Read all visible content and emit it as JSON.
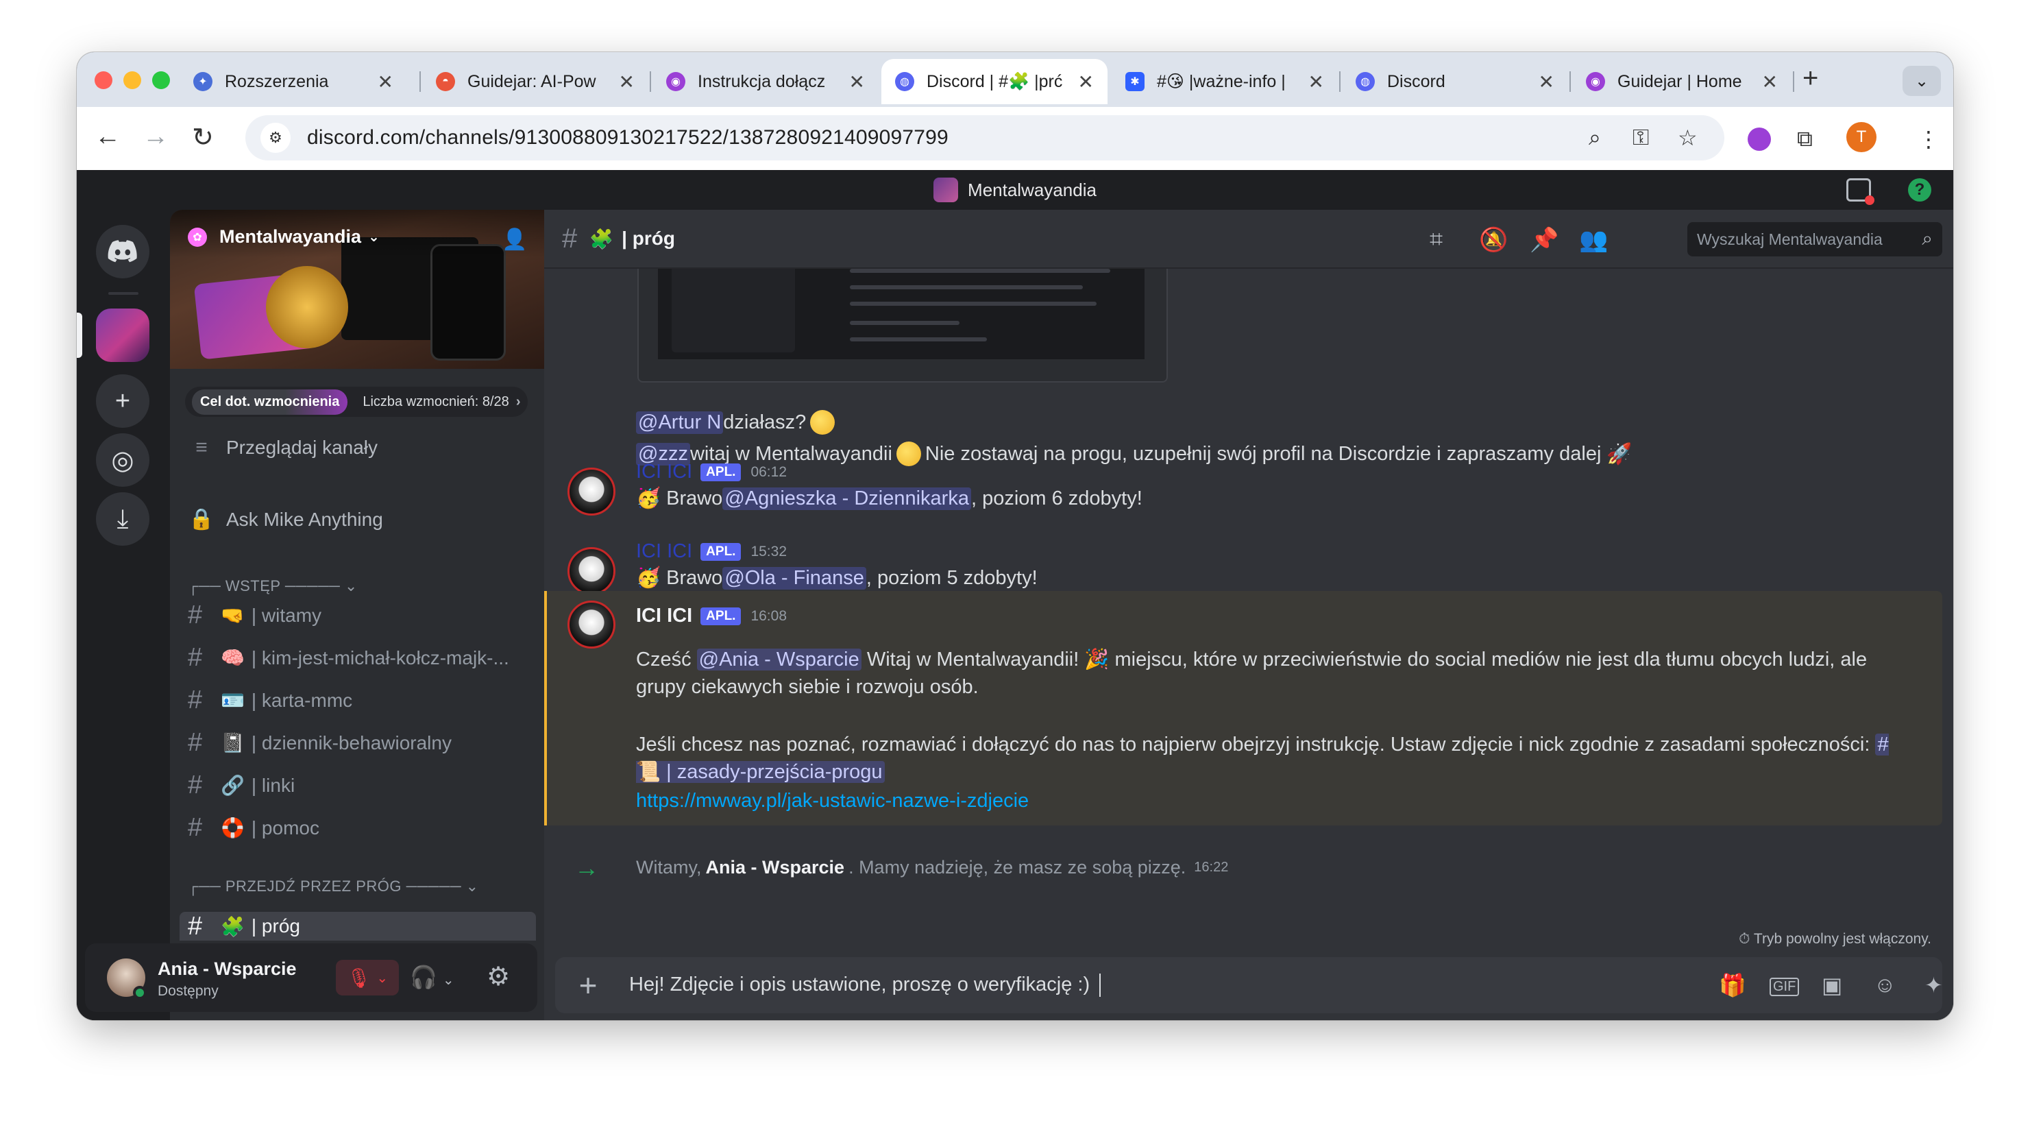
{
  "browser": {
    "tabs": [
      {
        "title": "Rozszerzenia",
        "active": false,
        "fav_color": "#4a6fd8",
        "fav_glyph": "✦"
      },
      {
        "title": "Guidejar: AI-Pow",
        "active": false,
        "fav_color": "#e9553b",
        "fav_glyph": "◓"
      },
      {
        "title": "Instrukcja dołącz",
        "active": false,
        "fav_color": "#9b3fd6",
        "fav_glyph": "◉"
      },
      {
        "title": "Discord | #🧩 |prć",
        "active": true,
        "fav_color": "#5865f2",
        "fav_glyph": "◍"
      },
      {
        "title": "#😘 |ważne-info |",
        "active": false,
        "fav_color": "#2f61ff",
        "fav_glyph": "✱"
      },
      {
        "title": "Discord",
        "active": false,
        "fav_color": "#5865f2",
        "fav_glyph": "◍"
      },
      {
        "title": "Guidejar | Home",
        "active": false,
        "fav_color": "#9b3fd6",
        "fav_glyph": "◉"
      }
    ],
    "close_glyph": "✕",
    "newtab_glyph": "+",
    "tabsearch_glyph": "⌄",
    "url": "discord.com/channels/913008809130217522/1387280921409097799",
    "profile_initial": "T"
  },
  "app": {
    "server_name": "Mentalwayandia",
    "server_initial": "M",
    "boost": {
      "goal_label": "Cel dot. wzmocnienia",
      "count_label": "Liczba wzmocnień: 8/28"
    },
    "sidebar_links": [
      {
        "label": "Przeglądaj kanały",
        "icon": "≡"
      },
      {
        "label": "Ask Mike Anything",
        "icon": "🔒"
      }
    ],
    "categories": [
      {
        "label": "┌── WSTĘP ───── ⌄"
      },
      {
        "label": "┌── PRZEJDŹ PRZEZ PRÓG ───── ⌄"
      }
    ],
    "channels_intro": [
      {
        "emoji": "🤜",
        "name": "| witamy"
      },
      {
        "emoji": "🧠",
        "name": "| kim-jest-michał-kołcz-majk-..."
      },
      {
        "emoji": "🪪",
        "name": "| karta-mmc"
      },
      {
        "emoji": "📓",
        "name": "| dziennik-behawioralny"
      },
      {
        "emoji": "🔗",
        "name": "| linki"
      },
      {
        "emoji": "🛟",
        "name": "| pomoc"
      }
    ],
    "channel_active": {
      "emoji": "🧩",
      "name": "| próg"
    },
    "user": {
      "name": "Ania - Wsparcie",
      "status": "Dostępny"
    },
    "chat": {
      "channel_title": "| próg",
      "channel_emoji": "🧩",
      "search_placeholder": "Wyszukaj Mentalwayandia",
      "line1": {
        "mention": "@Artur N",
        "text": " działasz?"
      },
      "line2": {
        "mention": "@zzz",
        "text_a": " witaj w Mentalwayandii",
        "text_b": " Nie zostawaj na progu, uzupełnij swój profil na Discordzie i zapraszamy dalej"
      },
      "msg1": {
        "author": "ICI ICI",
        "tag": "APL.",
        "time": "06:12",
        "emoji": "🥳",
        "pre": "Brawo ",
        "mention": "@Agnieszka - Dziennikarka",
        "post": ", poziom 6 zdobyty!"
      },
      "msg2": {
        "author": "ICI ICI",
        "tag": "APL.",
        "time": "15:32",
        "emoji": "🥳",
        "pre": "Brawo ",
        "mention": "@Ola - Finanse",
        "post": ", poziom 5 zdobyty!"
      },
      "msg3": {
        "author": "ICI ICI",
        "tag": "APL.",
        "time": "16:08",
        "p1_pre": "Cześć ",
        "p1_mention": "@Ania - Wsparcie",
        "p1_mid": " Witaj w Mentalwayandii! 🎉 miejscu, które w przeciwieństwie do social mediów nie jest dla tłumu obcych ludzi, ale grupy ciekawych siebie i rozwoju osób.",
        "p2_text": "Jeśli chcesz nas poznać, rozmawiać i dołączyć do nas to najpierw obejrzyj instrukcję. Ustaw zdjęcie i nick zgodnie z zasadami społeczności: ",
        "p2_channel": "# 📜 | zasady-przejścia-progu",
        "link": "https://mwway.pl/jak-ustawic-nazwe-i-zdjecie"
      },
      "system": {
        "pre": "Witamy,",
        "name": "Ania - Wsparcie",
        "post": ". Mamy nadzieję, że masz ze sobą pizzę.",
        "time": "16:22"
      },
      "slowmode": "⏱ Tryb powolny jest włączony.",
      "composer_text": "Hej! Zdjęcie i opis ustawione, proszę o weryfikację :)"
    }
  },
  "icons": {
    "back": "←",
    "forward": "→",
    "reload": "↻",
    "tune": "⚙",
    "zoom": "⌕",
    "key": "⚿",
    "star": "☆",
    "extensions": "⧉",
    "menu": "⋮",
    "plus": "+",
    "compass": "◎",
    "download": "⤓",
    "hash": "#",
    "invite": "👤",
    "threads": "⌗",
    "bell_off": "🔕",
    "pin": "📌",
    "members": "👥",
    "search": "⌕",
    "gift": "🎁",
    "gif": "GIF",
    "sticker": "▣",
    "emoji": "☺",
    "apps": "✦",
    "mute": "🎙",
    "headphones": "🎧",
    "gear": "⚙",
    "chevron": "⌄",
    "arrow_right": "→"
  }
}
